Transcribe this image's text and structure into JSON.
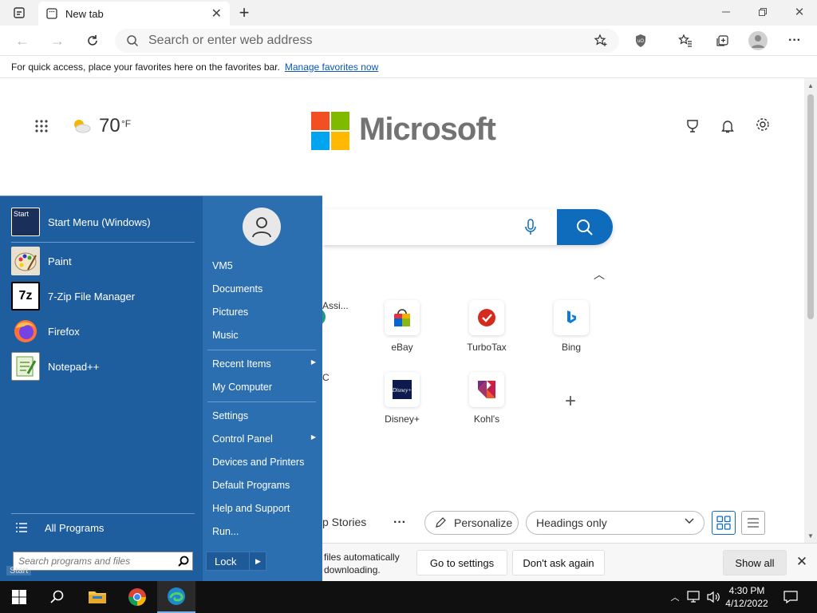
{
  "browser": {
    "tab_title": "New tab",
    "address_placeholder": "Search or enter web address",
    "favbar_text": "For quick access, place your favorites here on the favorites bar.",
    "favbar_link": "Manage favorites now"
  },
  "newtab": {
    "weather_temp": "70",
    "weather_unit": "°F",
    "brand": "Microsoft",
    "tiles_row1": [
      "Assi...",
      "eBay",
      "TurboTax",
      "Bing"
    ],
    "tiles_row2": [
      "C",
      "Disney+",
      "Kohl's"
    ],
    "feed_label": "p Stories",
    "personalize": "Personalize",
    "headings": "Headings only"
  },
  "download_bar": {
    "text_line1": "files automatically",
    "text_line2": "downloading.",
    "go_settings": "Go to settings",
    "dont_ask": "Don't ask again",
    "show_all": "Show all"
  },
  "start_menu": {
    "pinned_title": "Start Menu (Windows)",
    "pinned_icon_text": "Start",
    "programs": [
      {
        "label": "Paint",
        "icon": "paint-icon"
      },
      {
        "label": "7-Zip File Manager",
        "icon": "7zip-icon",
        "icon_text": "7z"
      },
      {
        "label": "Firefox",
        "icon": "firefox-icon"
      },
      {
        "label": "Notepad++",
        "icon": "notepadpp-icon"
      }
    ],
    "all_programs": "All Programs",
    "search_placeholder": "Search programs and files",
    "right_items": [
      "VM5",
      "Documents",
      "Pictures",
      "Music",
      "Recent Items",
      "My Computer",
      "Settings",
      "Control Panel",
      "Devices and Printers",
      "Default Programs",
      "Help and Support",
      "Run..."
    ],
    "lock": "Lock",
    "start_tooltip": "Start"
  },
  "taskbar": {
    "time": "4:30 PM",
    "date": "4/12/2022"
  },
  "colors": {
    "accent": "#0f6cbd",
    "start_menu": "#2b6fb0",
    "taskbar": "#101010"
  }
}
